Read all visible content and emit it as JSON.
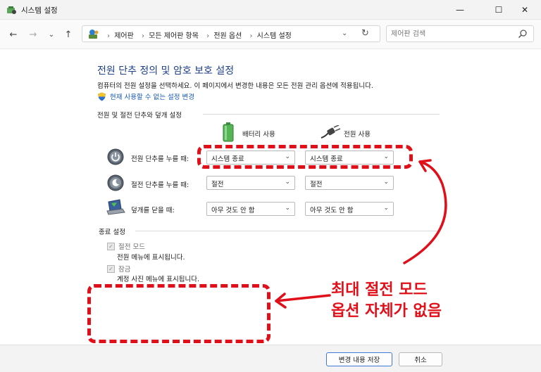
{
  "window": {
    "title": "시스템 설정",
    "controls": {
      "minimize": "—",
      "maximize": "☐",
      "close": "✕"
    }
  },
  "nav": {
    "back": "←",
    "forward": "→",
    "recent": "⌄",
    "up": "↑",
    "breadcrumbs": [
      "제어판",
      "모든 제어판 항목",
      "전원 옵션",
      "시스템 설정"
    ],
    "crumb_sep": "›",
    "dropdown": "⌄",
    "refresh": "↻",
    "search_placeholder": "제어판 검색"
  },
  "content": {
    "heading": "전원 단추 정의 및 암호 보호 설정",
    "description": "컴퓨터의 전원 설정을 선택하세요. 이 페이지에서 변경한 내용은 모든 전원 관리 옵션에 적용됩니다.",
    "change_link": "현재 사용할 수 없는 설정 변경",
    "power_section_title": "전원 및 절전 단추와 덮개 설정",
    "columns": {
      "battery": "배터리 사용",
      "plugged": "전원 사용"
    },
    "rows": [
      {
        "label": "전원 단추를 누를 때:",
        "battery": "시스템 종료",
        "plugged": "시스템 종료"
      },
      {
        "label": "절전 단추를 누를 때:",
        "battery": "절전",
        "plugged": "절전"
      },
      {
        "label": "덮개를 닫을 때:",
        "battery": "아무 것도 안 함",
        "plugged": "아무 것도 안 함"
      }
    ],
    "shutdown_section_title": "종료 설정",
    "shutdown_options": [
      {
        "label": "절전 모드",
        "desc": "전원 메뉴에 표시됩니다.",
        "checked": true
      },
      {
        "label": "잠금",
        "desc": "계정 사진 메뉴에 표시됩니다.",
        "checked": true
      }
    ],
    "check_mark": "✓",
    "chevron": "⌄"
  },
  "annotation": {
    "line1": "최대 절전 모드",
    "line2": "옵션 자체가 없음",
    "color": "#e0101a"
  },
  "footer": {
    "save": "변경 내용 저장",
    "cancel": "취소"
  }
}
